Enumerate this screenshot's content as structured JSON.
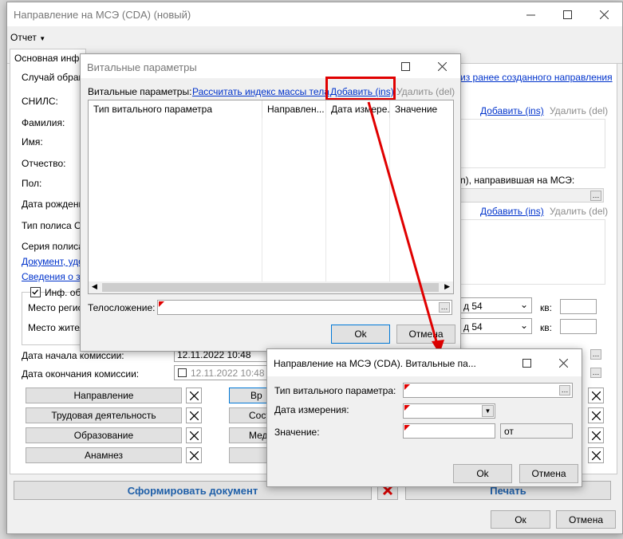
{
  "main": {
    "title": "Направление на МСЭ (CDA) (новый)",
    "menu_report": "Отчет",
    "tab_main": "Основная инфор",
    "left_labels": [
      "Случай обращ",
      "СНИЛС:",
      "Фамилия:",
      "Имя:",
      "Отчество:",
      "Пол:",
      "Дата рождени",
      "Тип полиса ОМ",
      "Серия полиса:"
    ],
    "left_links": [
      "Документ, удо",
      "Сведения о за"
    ],
    "inf_checkbox": "Инф. об а",
    "place_reg": "Место регист",
    "place_live": "Место жител",
    "right_link_prev": "из ранее созданного направления",
    "right_add_1": "Добавить (ins)",
    "right_del_1": "Удалить (del)",
    "right_org_label": "n), направившая на МСЭ:",
    "right_add_2": "Добавить (ins)",
    "right_del_2": "Удалить (del)",
    "addr_1": "д 54",
    "addr_2": "д 54",
    "kv_label": "кв:",
    "commission_start_label": "Дата начала комиссии:",
    "commission_start_value": "12.11.2022 10:48",
    "commission_end_label": "Дата окончания комиссии:",
    "commission_end_value": "12.11.2022 10:48",
    "section_buttons": [
      "Направление",
      "Трудовая деятельность",
      "Образование",
      "Анамнез"
    ],
    "section_buttons_right": [
      "Вр",
      "Сост",
      "Мед",
      ""
    ],
    "form_doc_button": "Сформировать документ",
    "print_button": "Печать",
    "ok": "Ок",
    "cancel": "Отмена"
  },
  "vital": {
    "title": "Витальные параметры",
    "label": "Витальные параметры:",
    "bmi_link": "Рассчитать индекс массы тела",
    "add": "Добавить (ins)",
    "del": "Удалить (del)",
    "columns": [
      "Тип витального параметра",
      "Направлен...",
      "Дата измере...",
      "Значение"
    ],
    "body_label": "Телосложение:",
    "ok": "Ok",
    "cancel": "Отмена"
  },
  "dialog": {
    "title": "Направление на МСЭ (CDA). Витальные па...",
    "type_label": "Тип витального параметра:",
    "date_label": "Дата измерения:",
    "value_label": "Значение:",
    "unit_value": "от",
    "ok": "Ok",
    "cancel": "Отмена"
  },
  "colors": {
    "accent": "#0078d7",
    "link": "#0033cc",
    "highlight": "#e00000"
  }
}
